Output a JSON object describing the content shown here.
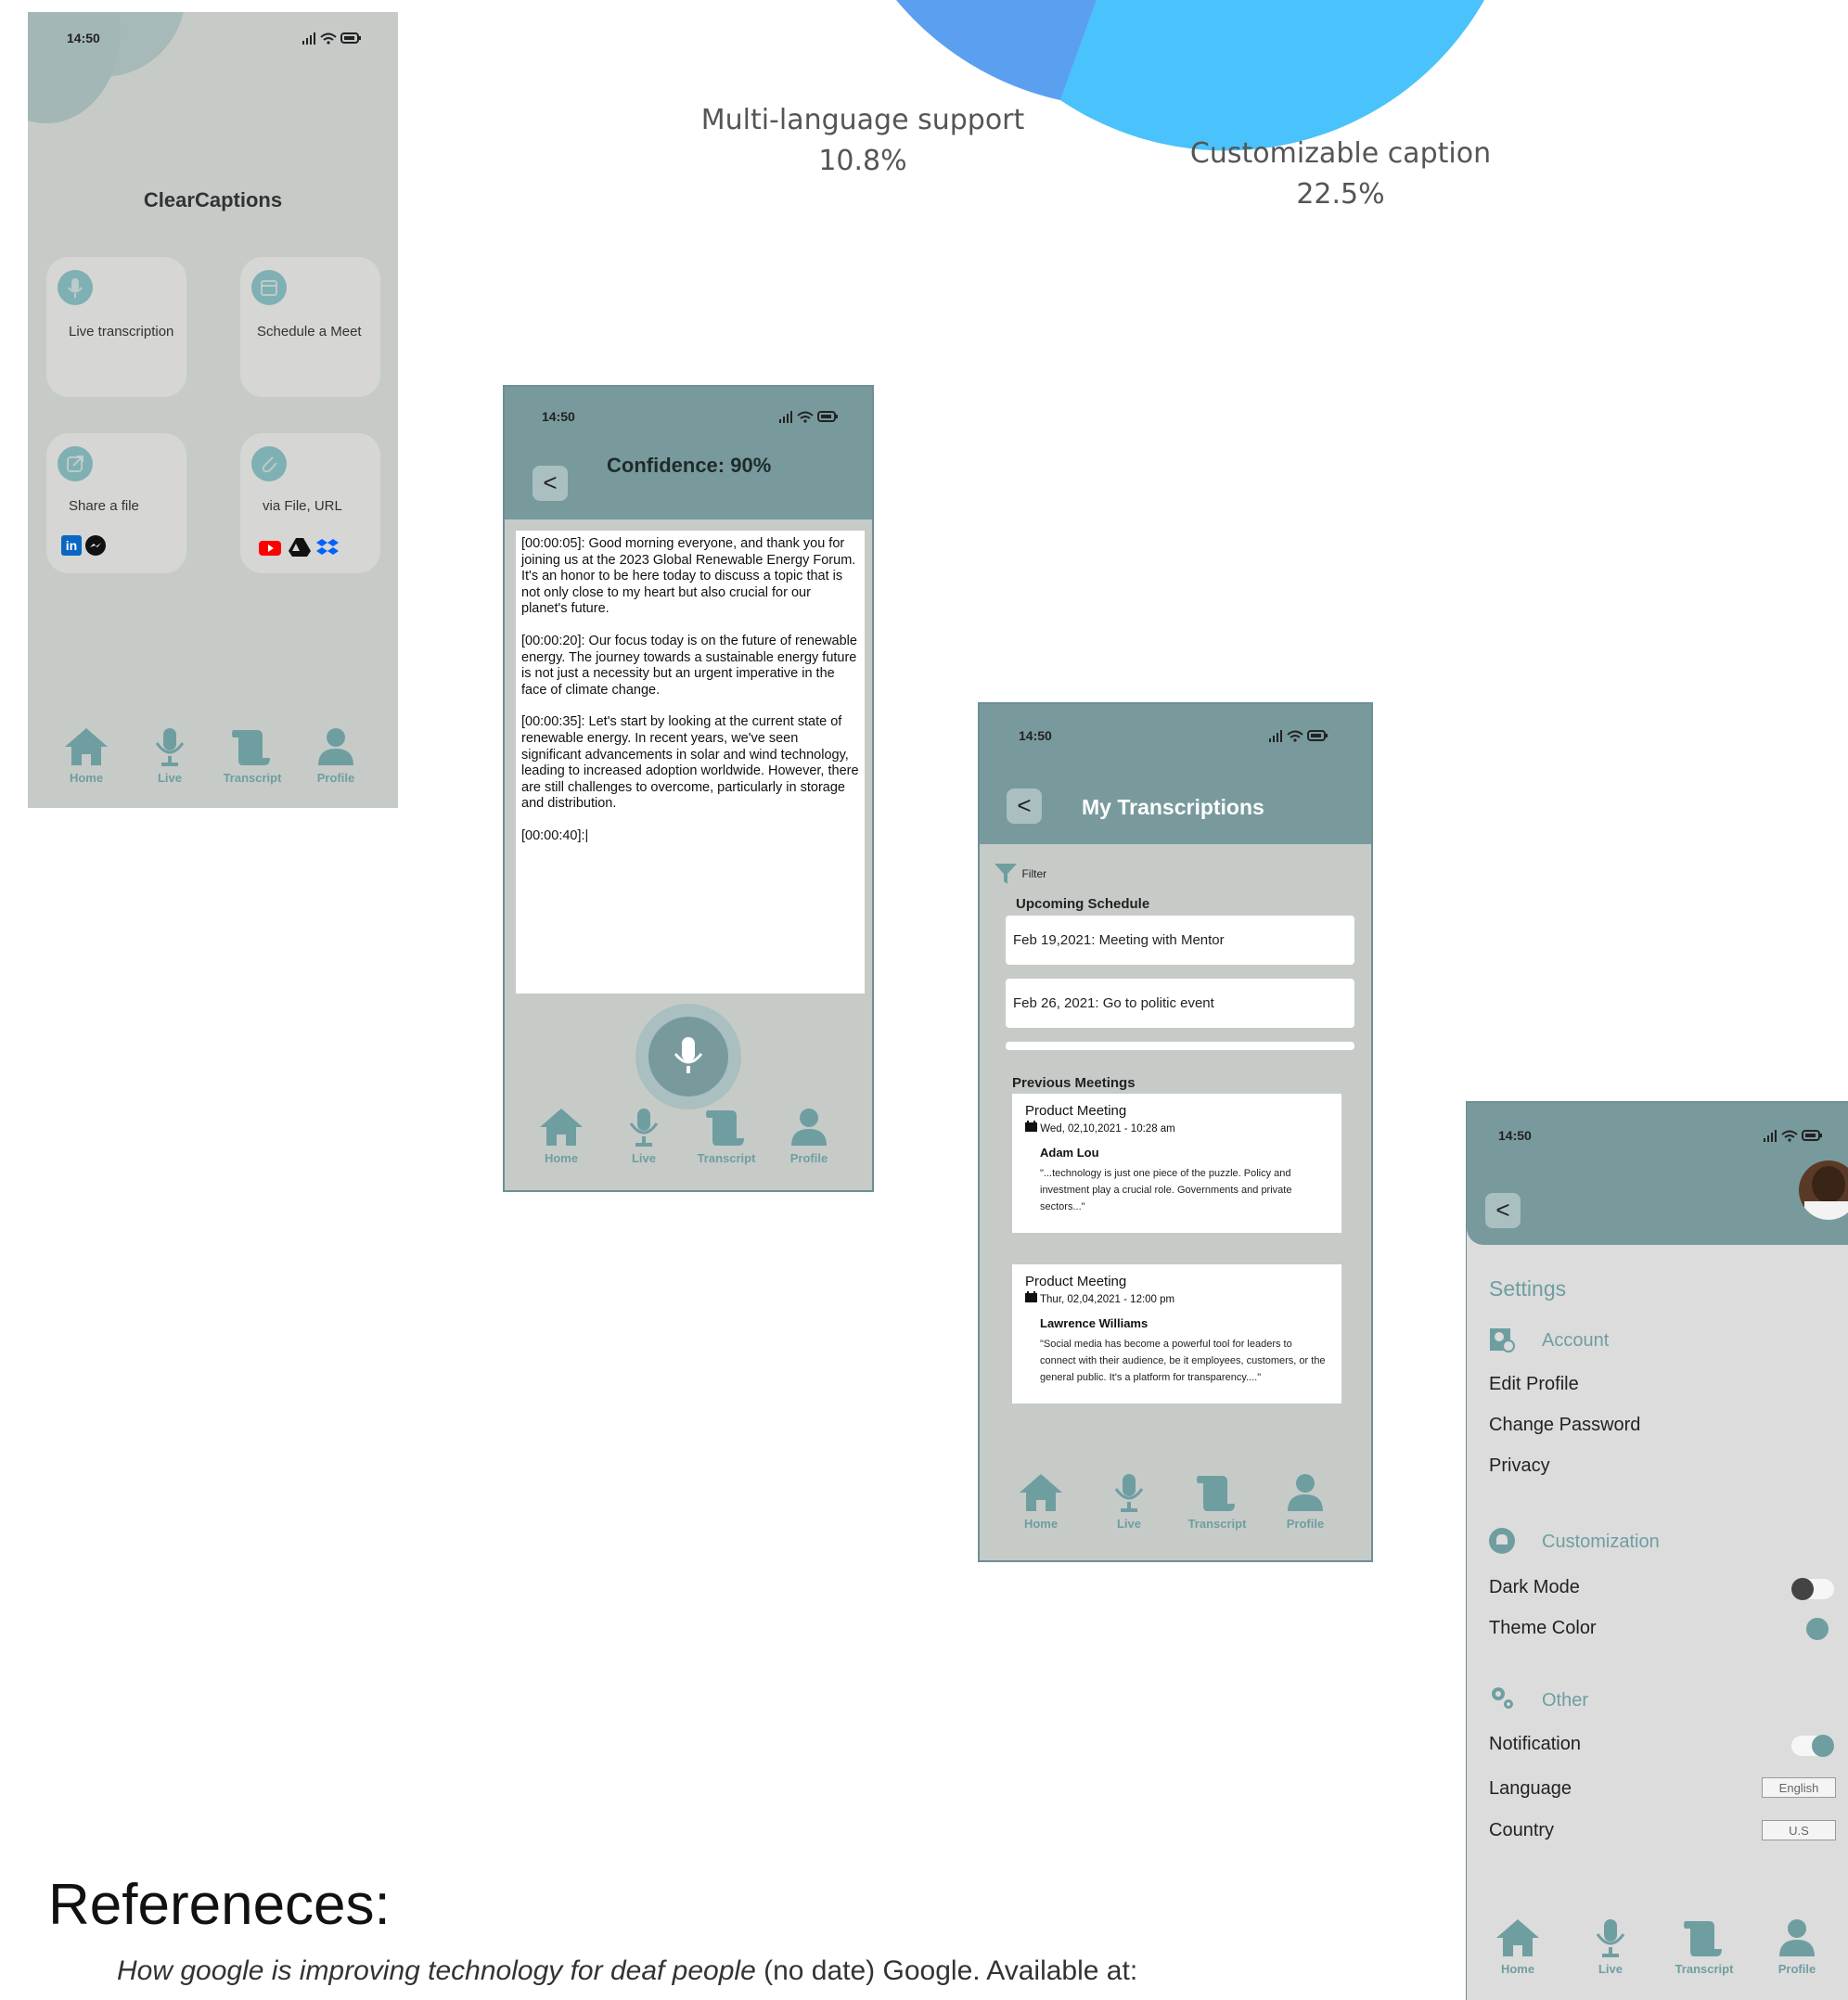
{
  "pie": {
    "labels": [
      {
        "name": "Multi-language support",
        "value": "10.8%"
      },
      {
        "name": "Customizable caption",
        "value": "22.5%"
      }
    ],
    "colors": {
      "slice_a": "#5b9ff1",
      "slice_b": "#4ac2fb"
    }
  },
  "common": {
    "time": "14:50",
    "nav": {
      "home": "Home",
      "live": "Live",
      "transcript": "Transcript",
      "profile": "Profile"
    }
  },
  "home_screen": {
    "title": "ClearCaptions",
    "tiles": [
      {
        "label": "Live transcription",
        "icon": "mic-icon"
      },
      {
        "label": "Schedule a Meet",
        "icon": "calendar-icon"
      },
      {
        "label": "Share a file",
        "icon": "share-icon"
      },
      {
        "label": "via File, URL",
        "icon": "paperclip-icon"
      }
    ]
  },
  "live_screen": {
    "back": "<",
    "title": "Confidence: 90%",
    "paragraphs": [
      "[00:00:05]: Good morning everyone, and thank you for joining us at the 2023 Global Renewable Energy Forum. It's an honor to be here today to discuss a topic that is not only close to my heart but also crucial for our planet's future.",
      "[00:00:20]: Our focus today is on the future of renewable energy. The journey towards a sustainable energy future is not just a necessity but an urgent imperative in the face of climate change.",
      "[00:00:35]: Let's start by looking at the current state of renewable energy. In recent years, we've seen significant advancements in solar and wind technology, leading to increased adoption worldwide. However, there are still challenges to overcome, particularly in storage and distribution.",
      "[00:00:40]:|"
    ]
  },
  "transcriptions_screen": {
    "back": "<",
    "title": "My Transcriptions",
    "filter": "Filter",
    "upcoming_heading": "Upcoming Schedule",
    "upcoming": [
      "Feb 19,2021: Meeting with Mentor",
      "Feb 26, 2021: Go to politic event"
    ],
    "previous_heading": "Previous Meetings",
    "meetings": [
      {
        "title": "Product Meeting",
        "date": "Wed, 02,10,2021 - 10:28 am",
        "person": "Adam Lou",
        "quote": "\"...technology is just one piece of the puzzle. Policy and investment play a crucial role. Governments and private sectors...\""
      },
      {
        "title": "Product Meeting",
        "date": "Thur, 02,04,2021 - 12:00 pm",
        "person": "Lawrence Williams",
        "quote": "\"Social media has become a powerful tool for leaders to connect with their audience, be it employees, customers, or the general public. It's a platform for transparency....\""
      }
    ]
  },
  "settings_screen": {
    "back": "<",
    "title": "Settings",
    "account_heading": "Account",
    "account_items": [
      "Edit Profile",
      "Change Password",
      "Privacy"
    ],
    "custom_heading": "Customization",
    "dark_mode": "Dark Mode",
    "dark_mode_on": false,
    "theme_color": "Theme Color",
    "theme_color_value": "#6f9ea1",
    "other_heading": "Other",
    "notification": "Notification",
    "notification_on": true,
    "language": "Language",
    "language_value": "English",
    "country": "Country",
    "country_value": "U.S"
  },
  "references": {
    "title": "Refereneces:",
    "entry_title": "How google is improving technology for deaf people",
    "entry_rest": " (no date) Google. Available at:"
  }
}
